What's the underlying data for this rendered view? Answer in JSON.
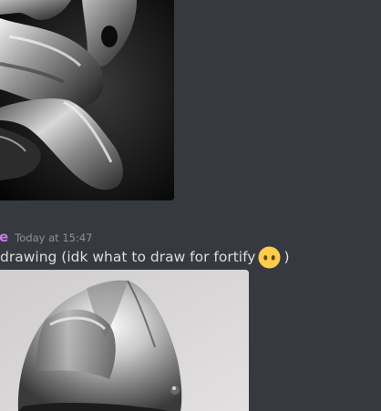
{
  "message_top": {
    "image_alt": "grayscale drawing of a gloved hand"
  },
  "message": {
    "username": "e",
    "timestamp": "Today at 15:47",
    "text_before_emoji": "drawing (idk what to draw for fortify",
    "emoji": "no-mouth-emoji",
    "text_after_emoji": ")",
    "image_alt": "drawing of a knight helmet"
  },
  "colors": {
    "background": "#36393f",
    "username": "#c27ee8",
    "timestamp": "#8e9297",
    "text": "#dcddde",
    "emoji": "#ffcc4d"
  }
}
